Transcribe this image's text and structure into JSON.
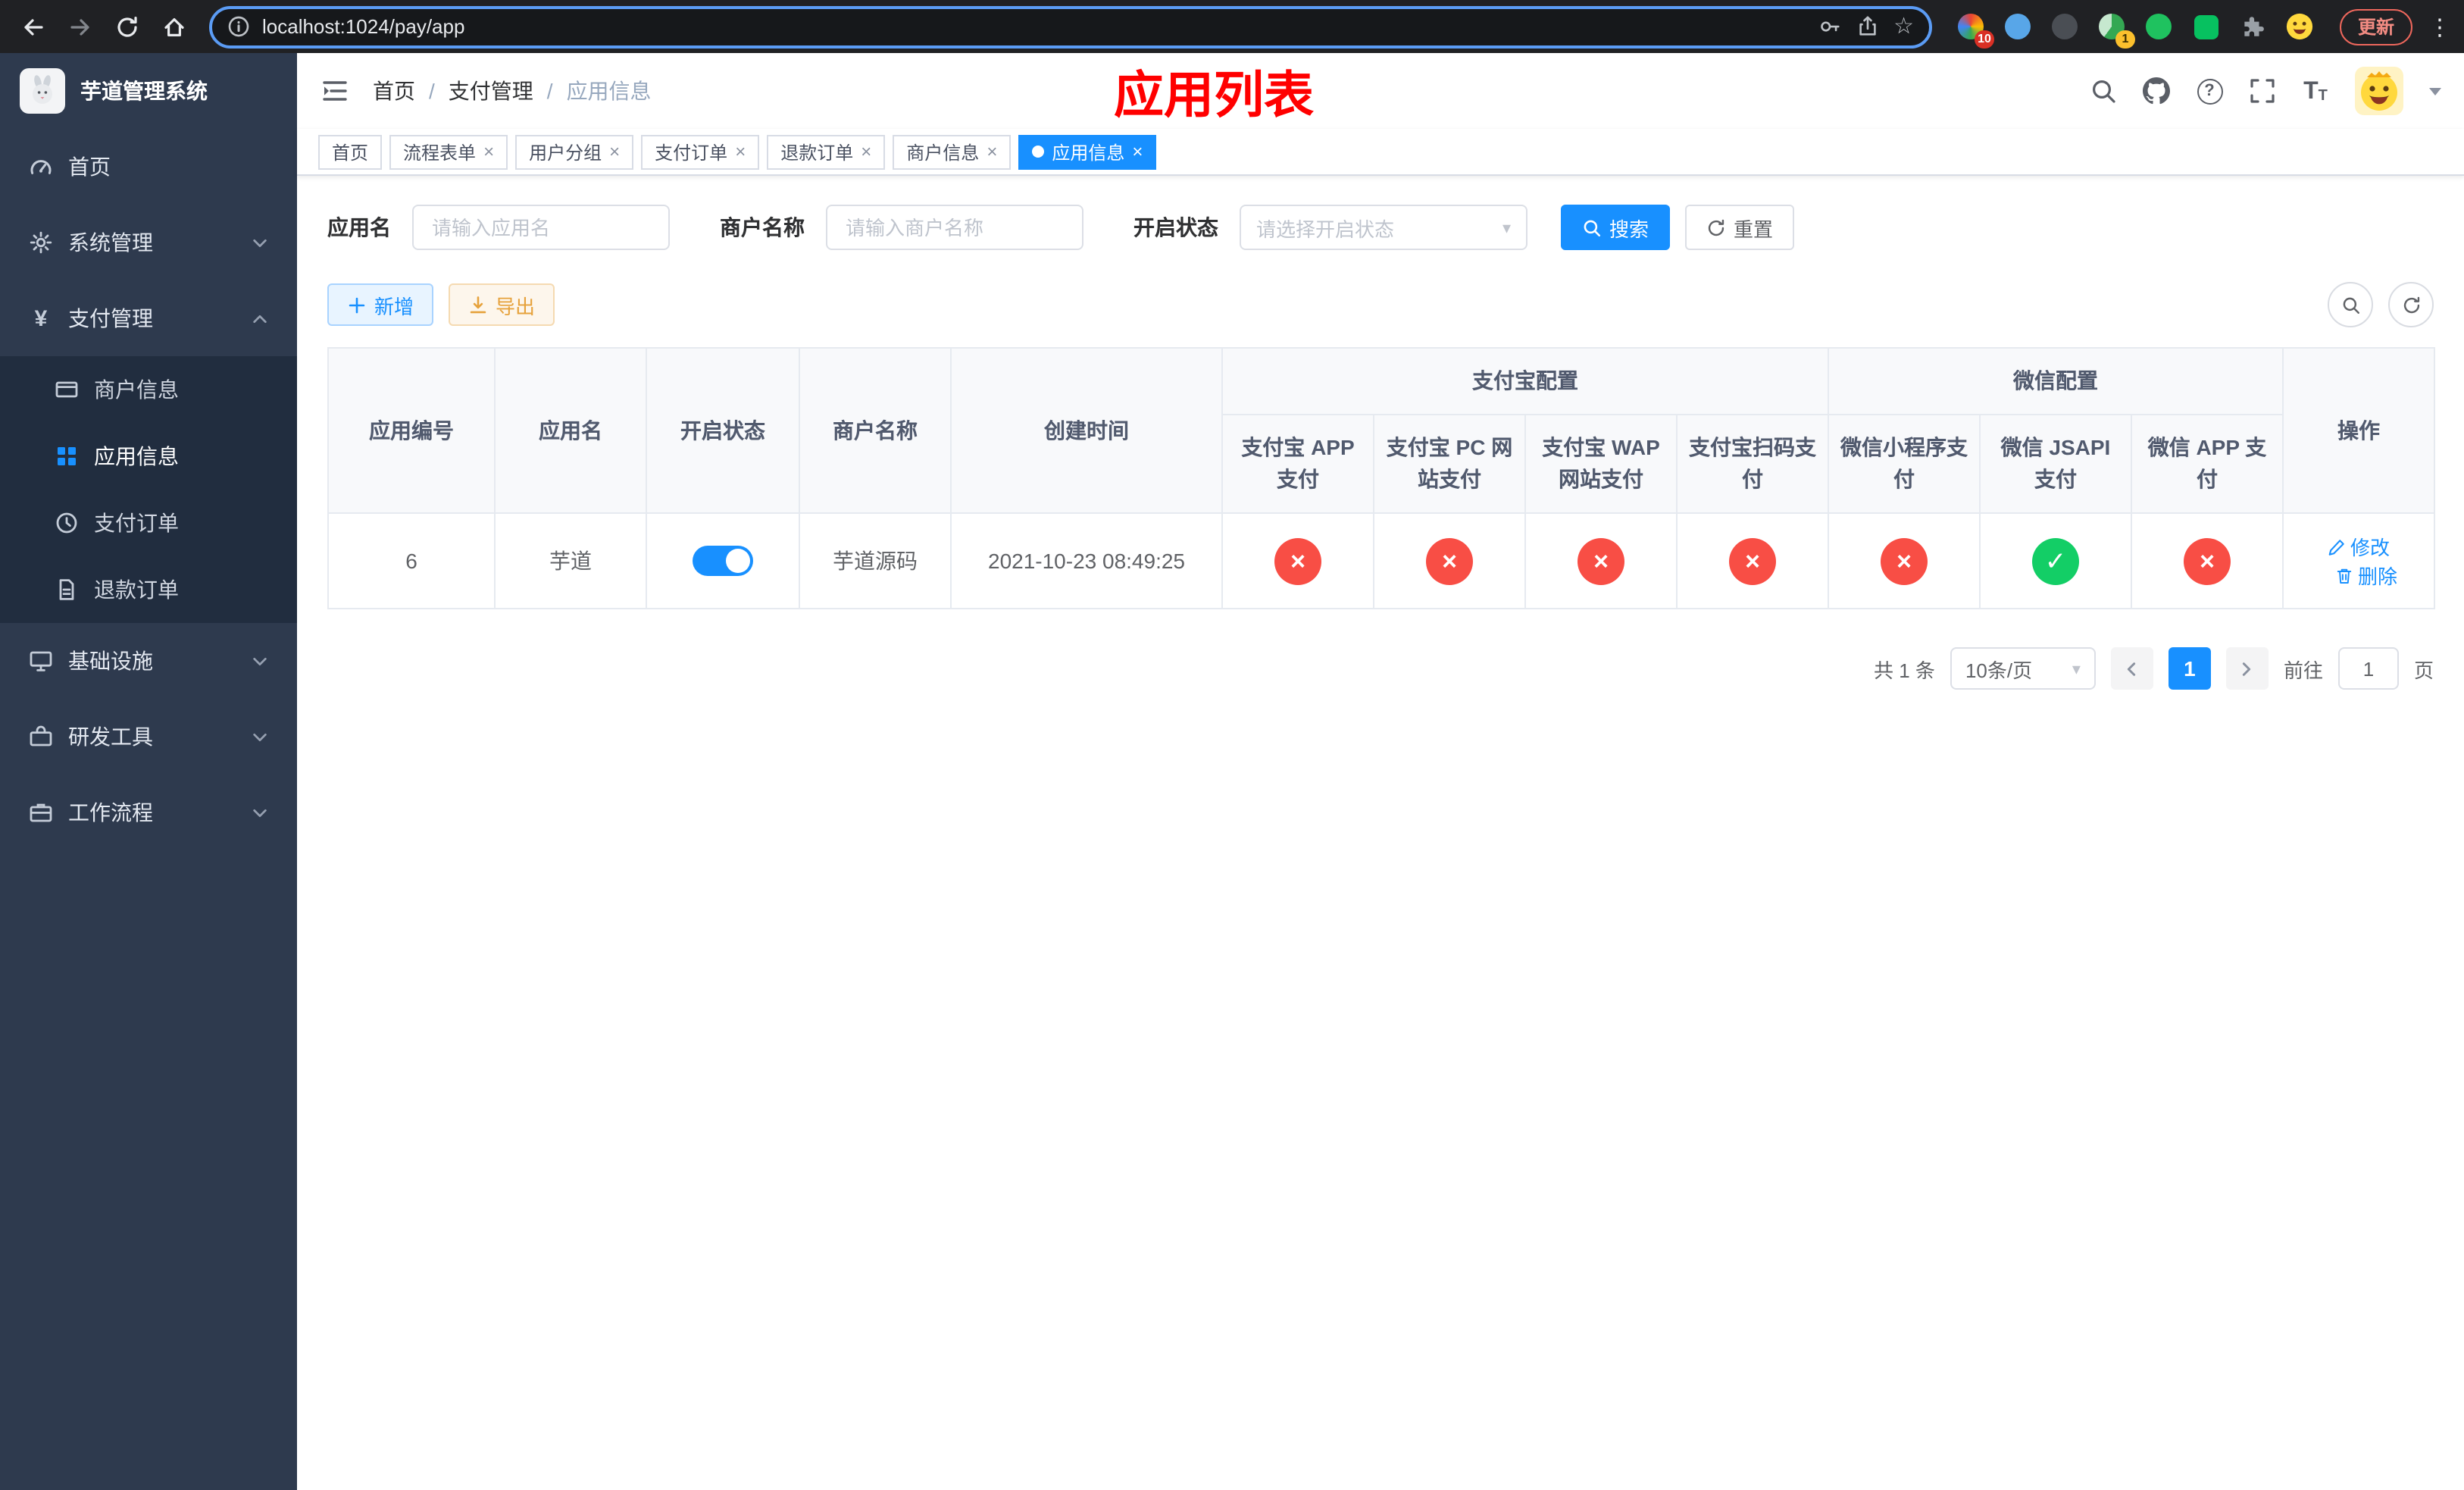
{
  "colors": {
    "primary": "#1890ff",
    "danger": "#f84e45",
    "success": "#13ce66",
    "warning": "#e6a23c"
  },
  "browser": {
    "url": "localhost:1024/pay/app",
    "update_label": "更新",
    "extension_badges": {
      "first": "10",
      "fourth": "1"
    }
  },
  "sidebar": {
    "title": "芋道管理系统",
    "items": [
      {
        "label": "首页"
      },
      {
        "label": "系统管理"
      },
      {
        "label": "支付管理"
      },
      {
        "label": "商户信息"
      },
      {
        "label": "应用信息"
      },
      {
        "label": "支付订单"
      },
      {
        "label": "退款订单"
      },
      {
        "label": "基础设施"
      },
      {
        "label": "研发工具"
      },
      {
        "label": "工作流程"
      }
    ]
  },
  "header": {
    "breadcrumb": [
      {
        "label": "首页"
      },
      {
        "label": "支付管理"
      },
      {
        "label": "应用信息"
      }
    ],
    "annotation": "应用列表"
  },
  "tabs": [
    {
      "label": "首页"
    },
    {
      "label": "流程表单"
    },
    {
      "label": "用户分组"
    },
    {
      "label": "支付订单"
    },
    {
      "label": "退款订单"
    },
    {
      "label": "商户信息"
    },
    {
      "label": "应用信息"
    }
  ],
  "filters": {
    "app_name_label": "应用名",
    "app_name_placeholder": "请输入应用名",
    "merchant_label": "商户名称",
    "merchant_placeholder": "请输入商户名称",
    "status_label": "开启状态",
    "status_placeholder": "请选择开启状态",
    "search_label": "搜索",
    "reset_label": "重置"
  },
  "toolbar": {
    "add_label": "新增",
    "export_label": "导出"
  },
  "table": {
    "groups": {
      "alipay": "支付宝配置",
      "wechat": "微信配置"
    },
    "columns": {
      "id": "应用编号",
      "name": "应用名",
      "status": "开启状态",
      "merchant": "商户名称",
      "created": "创建时间",
      "alipay_app": "支付宝 APP 支付",
      "alipay_pc": "支付宝 PC 网站支付",
      "alipay_wap": "支付宝 WAP 网站支付",
      "alipay_qr": "支付宝扫码支付",
      "wx_lite": "微信小程序支付",
      "wx_jsapi": "微信 JSAPI 支付",
      "wx_app": "微信 APP 支付",
      "actions": "操作"
    },
    "row": {
      "id": "6",
      "name": "芋道",
      "status_on": true,
      "merchant": "芋道源码",
      "created": "2021-10-23 08:49:25",
      "configs": [
        false,
        false,
        false,
        false,
        false,
        true,
        false
      ],
      "edit_label": "修改",
      "delete_label": "删除"
    }
  },
  "pagination": {
    "total_label": "共 1 条",
    "page_size_label": "10条/页",
    "current_page": "1",
    "goto_label": "前往",
    "goto_value": "1",
    "goto_unit": "页"
  }
}
